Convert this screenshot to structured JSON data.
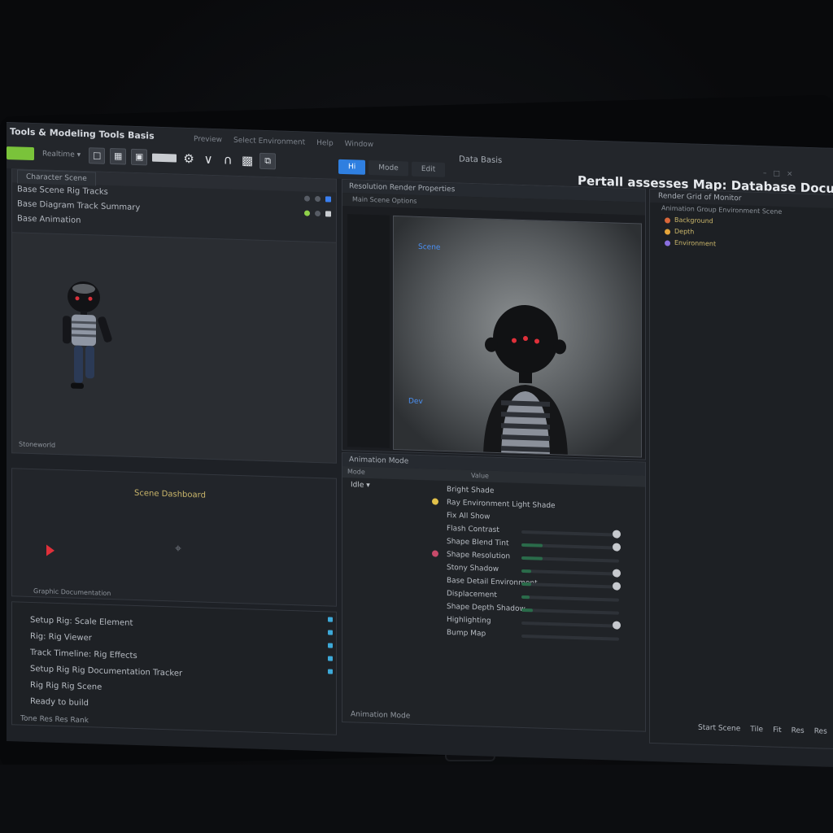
{
  "app": {
    "title": "Tools & Modeling Tools Basis"
  },
  "menu": [
    "Preview",
    "Select Environment",
    "Help",
    "Window"
  ],
  "center_title": "Data Basis",
  "toolbar": {
    "mode_label": "Realtime"
  },
  "tabs": [
    {
      "label": "Hi",
      "active": true
    },
    {
      "label": "Mode",
      "active": false
    },
    {
      "label": "Edit",
      "active": false
    }
  ],
  "main_heading": "Pertall assesses Map: Database Documents",
  "window_controls": [
    "–",
    "□",
    "×"
  ],
  "outliner": {
    "tab": "Character Scene",
    "rows": [
      "Base Scene Rig Tracks",
      "Base Diagram Track Summary",
      "Base Animation"
    ]
  },
  "viewport_left": {
    "label": "Stoneworld"
  },
  "graph": {
    "title": "Scene Dashboard",
    "footer": "Graphic Documentation"
  },
  "console": {
    "lines": [
      "Setup Rig: Scale Element",
      "Rig: Rig Viewer",
      "Track Timeline: Rig Effects",
      "Setup Rig Rig Documentation Tracker",
      "Rig Rig Rig Scene"
    ],
    "status": "Ready to build",
    "footer": "Tone Res Res Rank"
  },
  "preview": {
    "header": "Resolution Render Properties",
    "sub": "Main Scene Options",
    "tag_top": "Scene",
    "tag_bottom": "Dev"
  },
  "inspector": {
    "header": "Animation Mode",
    "col_left": "Mode",
    "col_right": "Value",
    "left_value": "Idle",
    "properties": [
      {
        "label": "Bright Shade",
        "fill": 0.0,
        "knob": false,
        "icon": ""
      },
      {
        "label": "Ray Environment Light Shade",
        "fill": 0.0,
        "knob": false,
        "icon": "#e2c14a"
      },
      {
        "label": "Fix All Show",
        "fill": 0.0,
        "knob": false,
        "icon": ""
      },
      {
        "label": "Flash Contrast",
        "fill": 0.0,
        "knob": true,
        "icon": ""
      },
      {
        "label": "Shape Blend Tint",
        "fill": 0.22,
        "knob": true,
        "icon": ""
      },
      {
        "label": "Shape Resolution",
        "fill": 0.22,
        "knob": false,
        "icon": "#c84a6a"
      },
      {
        "label": "Stony Shadow",
        "fill": 0.1,
        "knob": true,
        "icon": ""
      },
      {
        "label": "Base Detail Environment",
        "fill": 0.1,
        "knob": true,
        "icon": ""
      },
      {
        "label": "Displacement",
        "fill": 0.08,
        "knob": false,
        "icon": ""
      },
      {
        "label": "Shape Depth Shadow",
        "fill": 0.12,
        "knob": false,
        "icon": ""
      },
      {
        "label": "Highlighting",
        "fill": 0.0,
        "knob": true,
        "icon": ""
      },
      {
        "label": "Bump Map",
        "fill": 0.0,
        "knob": false,
        "icon": ""
      }
    ],
    "footer": "Animation Mode"
  },
  "layers": {
    "header": "Render Grid of Monitor",
    "sub": "Animation Group Environment Scene",
    "items": [
      {
        "label": "Background",
        "color": "#d9673a"
      },
      {
        "label": "Depth",
        "color": "#e6a53a"
      },
      {
        "label": "Environment",
        "color": "#8a6fe0"
      }
    ]
  },
  "status_right": [
    "Start Scene",
    "Tile",
    "Fit",
    "Res",
    "Res"
  ],
  "colors": {
    "accent": "#2f7fe0",
    "play": "#7ac33a"
  }
}
